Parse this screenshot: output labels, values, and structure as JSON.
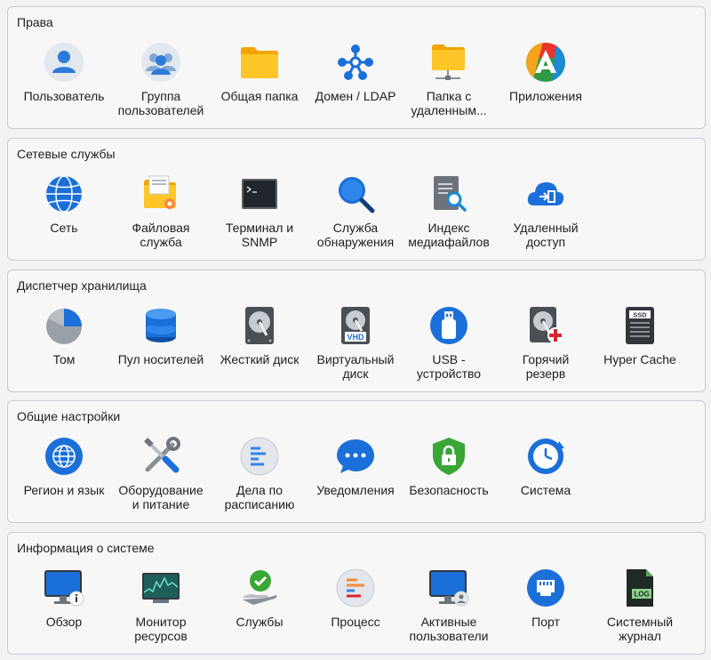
{
  "sections": [
    {
      "title": "Права",
      "items": [
        {
          "label": "Пользователь",
          "icon": "user-icon"
        },
        {
          "label": "Группа\nпользователей",
          "icon": "user-group-icon"
        },
        {
          "label": "Общая папка",
          "icon": "folder-icon"
        },
        {
          "label": "Домен / LDAP",
          "icon": "domain-ldap-icon"
        },
        {
          "label": "Папка с\nудаленным...",
          "icon": "remote-folder-icon"
        },
        {
          "label": "Приложения",
          "icon": "applications-icon"
        }
      ]
    },
    {
      "title": "Сетевые службы",
      "items": [
        {
          "label": "Сеть",
          "icon": "globe-icon"
        },
        {
          "label": "Файловая\nслужба",
          "icon": "file-service-icon"
        },
        {
          "label": "Терминал и\nSNMP",
          "icon": "terminal-icon"
        },
        {
          "label": "Служба\nобнаружения",
          "icon": "discovery-search-icon"
        },
        {
          "label": "Индекс\nмедиафайлов",
          "icon": "media-index-icon"
        },
        {
          "label": "Удаленный\nдоступ",
          "icon": "cloud-access-icon"
        }
      ]
    },
    {
      "title": "Диспетчер хранилища",
      "items": [
        {
          "label": "Том",
          "icon": "volume-pie-icon"
        },
        {
          "label": "Пул носителей",
          "icon": "storage-pool-icon"
        },
        {
          "label": "Жесткий диск",
          "icon": "hdd-icon"
        },
        {
          "label": "Виртуальный\nдиск",
          "icon": "vhd-icon",
          "badge": "VHD"
        },
        {
          "label": "USB -\nустройство",
          "icon": "usb-icon"
        },
        {
          "label": "Горячий\nрезерв",
          "icon": "hot-spare-icon"
        },
        {
          "label": "Hyper Cache",
          "icon": "ssd-cache-icon",
          "badge": "SSD"
        }
      ]
    },
    {
      "title": "Общие настройки",
      "items": [
        {
          "label": "Регион и язык",
          "icon": "region-globe-icon"
        },
        {
          "label": "Оборудование\nи питание",
          "icon": "tools-icon"
        },
        {
          "label": "Дела по\nрасписанию",
          "icon": "schedule-icon"
        },
        {
          "label": "Уведомления",
          "icon": "notification-bubble-icon"
        },
        {
          "label": "Безопасность",
          "icon": "security-shield-icon"
        },
        {
          "label": "Система",
          "icon": "system-clock-icon"
        }
      ]
    },
    {
      "title": "Информация о системе",
      "items": [
        {
          "label": "Обзор",
          "icon": "overview-monitor-icon"
        },
        {
          "label": "Монитор\nресурсов",
          "icon": "resource-monitor-icon"
        },
        {
          "label": "Службы",
          "icon": "services-check-icon"
        },
        {
          "label": "Процесс",
          "icon": "process-icon"
        },
        {
          "label": "Активные\nпользователи",
          "icon": "active-users-icon"
        },
        {
          "label": "Порт",
          "icon": "port-icon"
        },
        {
          "label": "Системный\nжурнал",
          "icon": "system-log-icon",
          "badge": "LOG"
        }
      ]
    }
  ],
  "colors": {
    "accent_blue": "#1b6fd8",
    "folder_yellow": "#ffc629",
    "green": "#3aa635",
    "red": "#d9262b",
    "orange": "#f28b3a"
  }
}
